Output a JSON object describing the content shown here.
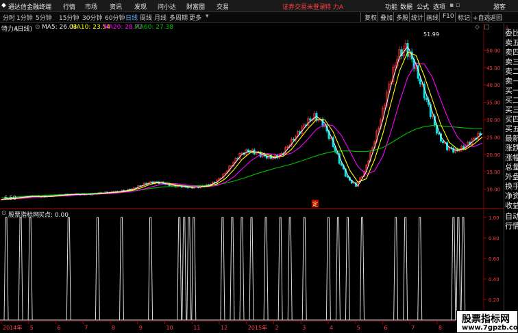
{
  "menubar": {
    "app_title": "通达信金融终端",
    "menus": [
      "行情",
      "市场",
      "资讯",
      "发现",
      "问小达",
      "财富圈",
      "交易"
    ],
    "center_notice": "证券交易未登录",
    "stock_name": "特 力A",
    "right_menus": [
      "功能",
      "数据",
      "公式",
      "选项"
    ],
    "guest": "游客"
  },
  "periodbar": {
    "periods": [
      "分时",
      "1分钟",
      "5分钟",
      "15分钟",
      "30分钟",
      "60分钟",
      "日线",
      "周线",
      "月线",
      "多周期",
      "更多"
    ],
    "active_period": "日线",
    "tools": [
      "复权",
      "叠加",
      "多股",
      "统计",
      "画线",
      "F10",
      "标记",
      "+自选",
      "返回"
    ]
  },
  "chart_header": {
    "stock": "特力A",
    "period": "(日线)",
    "ma5": "MA5: 26.03",
    "ma10": "MA10: 23.54",
    "ma20": "MA20: 28.72",
    "ma60": "MA60: 27.38"
  },
  "colors": {
    "up": "#ff3232",
    "down": "#00e6e6",
    "ma5": "#e8e8e8",
    "ma10": "#ffff00",
    "ma20": "#ff00ff",
    "ma60": "#00c000",
    "indicator": "#dddddd"
  },
  "price_axis": [
    "50.00",
    "45.00",
    "40.00",
    "35.00",
    "30.00",
    "25.00",
    "20.00",
    "15.00",
    "10.00"
  ],
  "price_high_label": "51.99",
  "price_low_label": "6.50",
  "marker_label": "定",
  "right_panel": [
    "委比",
    "卖五",
    "卖四",
    "卖三",
    "卖二",
    "卖一",
    "买一",
    "买二",
    "买三",
    "买四",
    "买五",
    "最新",
    "涨跌",
    "涨幅",
    "总量",
    "外盘",
    "换手",
    "净资",
    "收益",
    "自动",
    "行情"
  ],
  "indicator_header": {
    "name": "股票指标网",
    "value": "买点: 0.00"
  },
  "indicator_axis": [
    "1.00",
    "0.80",
    "0.60",
    "0.40",
    "0.20"
  ],
  "date_axis": [
    "2014年",
    "5",
    "6",
    "7",
    "8",
    "9",
    "10",
    "11",
    "12",
    "2015年",
    "2",
    "3",
    "4",
    "5",
    "6",
    "7",
    "8"
  ],
  "watermark": {
    "title": "股票指标网",
    "url": "www.7gpzb.com"
  },
  "chart_data": {
    "type": "line",
    "title": "特力A (日线)",
    "ylim": [
      5,
      55
    ],
    "y_ticks": [
      10,
      15,
      20,
      25,
      30,
      35,
      40,
      45,
      50
    ],
    "close": [
      7,
      7.3,
      7.5,
      7.8,
      8,
      7.8,
      8,
      8.2,
      8.4,
      8.5,
      8.5,
      8.6,
      8.8,
      9,
      9.2,
      9.5,
      10,
      11,
      11.8,
      12,
      11.5,
      11,
      10.8,
      10.5,
      10.7,
      11,
      12,
      14,
      17,
      20,
      21,
      20.5,
      19.5,
      19,
      20,
      23,
      26,
      29,
      31,
      29,
      24,
      18,
      13,
      11,
      15,
      22,
      30,
      40,
      48,
      51,
      46,
      39,
      32,
      25,
      22,
      21,
      22,
      24,
      26
    ],
    "ma60": [
      7.5,
      7.6,
      7.8,
      8,
      8.1,
      8.2,
      8.3,
      8.4,
      8.5,
      8.6,
      8.7,
      8.8,
      8.9,
      9,
      9.1,
      9.3,
      9.5,
      9.8,
      10.2,
      10.5,
      10.7,
      10.8,
      10.9,
      11,
      11,
      11.1,
      11.3,
      11.7,
      12.3,
      13,
      13.8,
      14.6,
      15.3,
      16,
      16.6,
      17.2,
      18,
      18.8,
      19.6,
      20.3,
      20.8,
      21,
      21,
      20.8,
      20.8,
      21.2,
      22,
      23.3,
      24.8,
      26.2,
      27.3,
      28,
      28.3,
      28.2,
      28,
      27.8,
      27.6,
      27.4,
      27.38
    ],
    "signals_x_fraction": [
      0.01,
      0.04,
      0.06,
      0.14,
      0.2,
      0.25,
      0.31,
      0.37,
      0.38,
      0.39,
      0.4,
      0.46,
      0.48,
      0.5,
      0.52,
      0.55,
      0.58,
      0.6,
      0.63,
      0.68,
      0.7,
      0.72,
      0.75,
      0.82,
      0.84,
      0.87,
      0.94,
      0.95,
      0.96
    ],
    "signal_value": 1.0
  }
}
